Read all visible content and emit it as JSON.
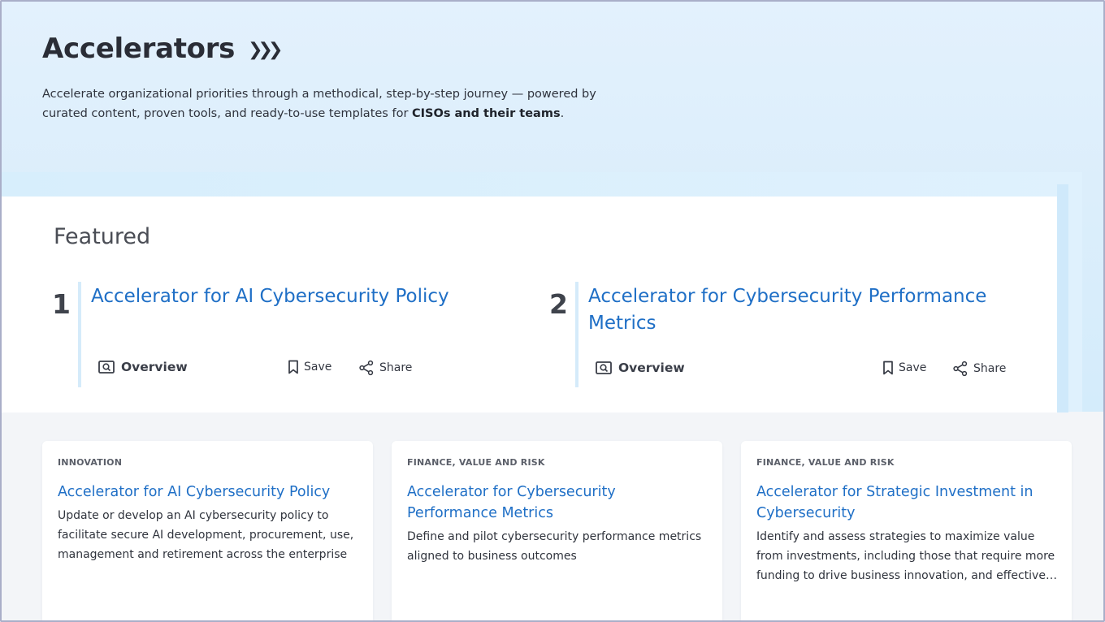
{
  "header": {
    "title": "Accelerators",
    "chevron": "❯❯❯",
    "intro_text": "Accelerate organizational priorities through a methodical, step-by-step journey — powered by curated content, proven tools, and ready-to-use templates for ",
    "intro_bold": "CISOs and their teams",
    "intro_end": "."
  },
  "featured": {
    "title": "Featured",
    "items": [
      {
        "number": "1",
        "title": "Accelerator for AI Cybersecurity Policy",
        "overview_label": "Overview",
        "save_label": "Save",
        "share_label": "Share"
      },
      {
        "number": "2",
        "title": "Accelerator for Cybersecurity Performance Metrics",
        "overview_label": "Overview",
        "save_label": "Save",
        "share_label": "Share"
      }
    ]
  },
  "cards": [
    {
      "category": "INNOVATION",
      "title": "Accelerator for AI Cybersecurity Policy",
      "description": "Update or develop an AI cybersecurity policy to facilitate secure AI development, procurement, use, management and retirement across the enterprise"
    },
    {
      "category": "FINANCE, VALUE AND RISK",
      "title": "Accelerator for Cybersecurity Performance Metrics",
      "description": "Define and pilot cybersecurity performance metrics aligned to business outcomes"
    },
    {
      "category": "FINANCE, VALUE AND RISK",
      "title": "Accelerator for Strategic Investment in Cybersecurity",
      "description": "Identify and assess strategies to maximize value from investments, including those that require more funding to drive business innovation, and effectively manage risk"
    }
  ],
  "colors": {
    "link": "#1f6fc6",
    "hero_bg": "#dceefb",
    "accent_bar": "#d5ebfa"
  },
  "icons": {
    "overview": "overview-icon",
    "save": "bookmark-icon",
    "share": "share-icon",
    "title_chevrons": "chevron-right-icon"
  }
}
